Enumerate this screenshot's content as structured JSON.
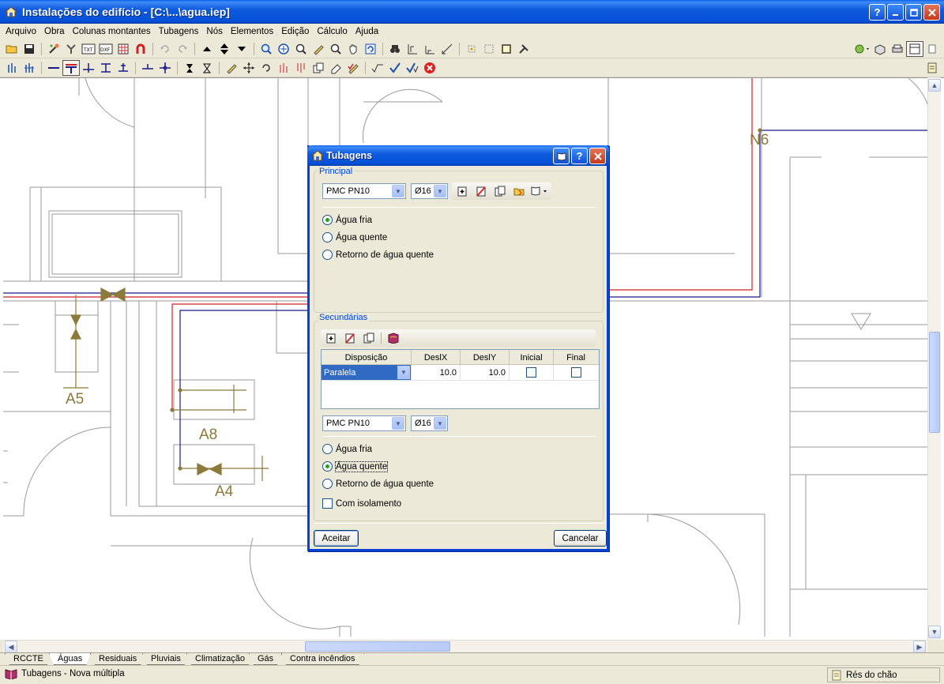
{
  "window": {
    "title": "Instalações do edifício - [C:\\...\\agua.iep]",
    "buttons": {
      "help": "?",
      "minimize": "_",
      "maximize": "□",
      "close": "✕"
    }
  },
  "menu": [
    "Arquivo",
    "Obra",
    "Colunas montantes",
    "Tubagens",
    "Nós",
    "Elementos",
    "Edição",
    "Cálculo",
    "Ajuda"
  ],
  "canvas": {
    "labels": {
      "a5": "A5",
      "a8": "A8",
      "a4": "A4",
      "n6": "N6"
    },
    "colors": {
      "background": "#FFFFFF",
      "walls": "#9A9A9A",
      "cold_pipe": "#1A1A8C",
      "hot_pipe": "#D42020",
      "fixtures": "#8B7A3A"
    }
  },
  "tabs": [
    "RCCTE",
    "Águas",
    "Residuais",
    "Pluviais",
    "Climatização",
    "Gás",
    "Contra incêndios"
  ],
  "active_tab": "Águas",
  "status": {
    "left": "Tubagens - Nova múltipla",
    "right": "Rés do chão"
  },
  "dialog": {
    "title": "Tubagens",
    "principal": {
      "label": "Principal",
      "material": "PMC PN10",
      "diameter": "Ø16",
      "radios": [
        "Água fria",
        "Água quente",
        "Retorno de água quente"
      ],
      "selected": "Água fria"
    },
    "secundarias": {
      "label": "Secundárias",
      "columns": [
        "Disposição",
        "DeslX",
        "DeslY",
        "Inicial",
        "Final"
      ],
      "rows": [
        {
          "disposicao": "Paralela",
          "deslx": "10.0",
          "desly": "10.0",
          "inicial": false,
          "final": false
        }
      ],
      "material": "PMC PN10",
      "diameter": "Ø16",
      "radios": [
        "Água fria",
        "Água quente",
        "Retorno de água quente"
      ],
      "selected": "Água quente",
      "checkbox": "Com isolamento",
      "checkbox_checked": false
    },
    "buttons": {
      "ok": "Aceitar",
      "cancel": "Cancelar"
    }
  }
}
